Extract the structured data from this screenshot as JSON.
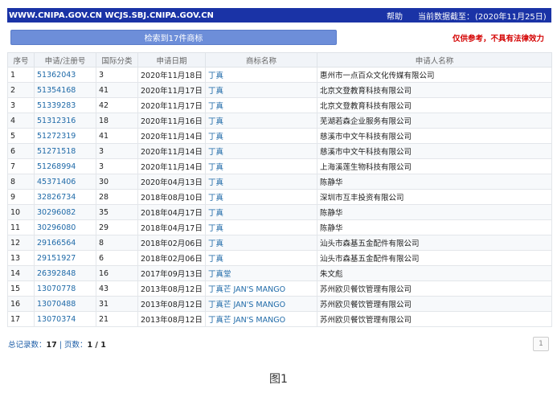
{
  "topbar": {
    "site": "WWW.CNIPA.GOV.CN WCJS.SBJ.CNIPA.GOV.CN",
    "help": "帮助",
    "data_date_label": "当前数据截至：",
    "data_date": "(2020年11月25日)"
  },
  "result_button": "检索到17件商标",
  "disclaimer": "仅供参考，不具有法律效力",
  "table": {
    "headers": [
      "序号",
      "申请/注册号",
      "国际分类",
      "申请日期",
      "商标名称",
      "申请人名称"
    ],
    "rows": [
      {
        "no": "1",
        "reg": "51362043",
        "cls": "3",
        "date": "2020年11月18日",
        "mark": "丁真",
        "applicant": "惠州市一点百众文化传媒有限公司"
      },
      {
        "no": "2",
        "reg": "51354168",
        "cls": "41",
        "date": "2020年11月17日",
        "mark": "丁真",
        "applicant": "北京文登教育科技有限公司"
      },
      {
        "no": "3",
        "reg": "51339283",
        "cls": "42",
        "date": "2020年11月17日",
        "mark": "丁真",
        "applicant": "北京文登教育科技有限公司"
      },
      {
        "no": "4",
        "reg": "51312316",
        "cls": "18",
        "date": "2020年11月16日",
        "mark": "丁真",
        "applicant": "芜湖若森企业服务有限公司"
      },
      {
        "no": "5",
        "reg": "51272319",
        "cls": "41",
        "date": "2020年11月14日",
        "mark": "丁真",
        "applicant": "慈溪市中文午科技有限公司"
      },
      {
        "no": "6",
        "reg": "51271518",
        "cls": "3",
        "date": "2020年11月14日",
        "mark": "丁真",
        "applicant": "慈溪市中文午科技有限公司"
      },
      {
        "no": "7",
        "reg": "51268994",
        "cls": "3",
        "date": "2020年11月14日",
        "mark": "丁真",
        "applicant": "上海溪莲生物科技有限公司"
      },
      {
        "no": "8",
        "reg": "45371406",
        "cls": "30",
        "date": "2020年04月13日",
        "mark": "丁真",
        "applicant": "陈静华"
      },
      {
        "no": "9",
        "reg": "32826734",
        "cls": "28",
        "date": "2018年08月10日",
        "mark": "丁真",
        "applicant": "深圳市互丰投资有限公司"
      },
      {
        "no": "10",
        "reg": "30296082",
        "cls": "35",
        "date": "2018年04月17日",
        "mark": "丁真",
        "applicant": "陈静华"
      },
      {
        "no": "11",
        "reg": "30296080",
        "cls": "29",
        "date": "2018年04月17日",
        "mark": "丁真",
        "applicant": "陈静华"
      },
      {
        "no": "12",
        "reg": "29166564",
        "cls": "8",
        "date": "2018年02月06日",
        "mark": "丁真",
        "applicant": "汕头市森基五金配件有限公司"
      },
      {
        "no": "13",
        "reg": "29151927",
        "cls": "6",
        "date": "2018年02月06日",
        "mark": "丁真",
        "applicant": "汕头市森基五金配件有限公司"
      },
      {
        "no": "14",
        "reg": "26392848",
        "cls": "16",
        "date": "2017年09月13日",
        "mark": "丁真堂",
        "applicant": "朱文彪"
      },
      {
        "no": "15",
        "reg": "13070778",
        "cls": "43",
        "date": "2013年08月12日",
        "mark": "丁真芒 JAN'S MANGO",
        "applicant": "苏州欧贝餐饮管理有限公司"
      },
      {
        "no": "16",
        "reg": "13070488",
        "cls": "31",
        "date": "2013年08月12日",
        "mark": "丁真芒 JAN'S MANGO",
        "applicant": "苏州欧贝餐饮管理有限公司"
      },
      {
        "no": "17",
        "reg": "13070374",
        "cls": "21",
        "date": "2013年08月12日",
        "mark": "丁真芒 JAN'S MANGO",
        "applicant": "苏州欧贝餐饮管理有限公司"
      }
    ]
  },
  "footer": {
    "total_label": "总记录数：",
    "total": "17",
    "sep": " | ",
    "pages_label": "页数：",
    "pages": "1 / 1",
    "page_button": "1"
  },
  "caption": "图1"
}
